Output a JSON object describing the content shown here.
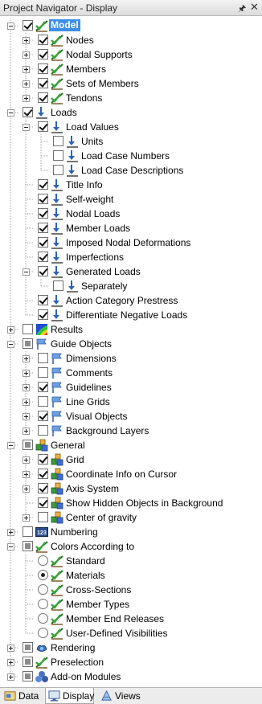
{
  "window": {
    "title": "Project Navigator - Display",
    "pin_icon": "pin-icon",
    "close_icon": "close-icon"
  },
  "tree": [
    {
      "level": 0,
      "label": "Model",
      "check": "checked",
      "icon": "model-icon",
      "expander": "minus",
      "selected": true
    },
    {
      "level": 1,
      "label": "Nodes",
      "check": "checked",
      "icon": "model-icon",
      "expander": "plus"
    },
    {
      "level": 1,
      "label": "Nodal Supports",
      "check": "checked",
      "icon": "model-icon",
      "expander": "plus"
    },
    {
      "level": 1,
      "label": "Members",
      "check": "checked",
      "icon": "model-icon",
      "expander": "plus"
    },
    {
      "level": 1,
      "label": "Sets of Members",
      "check": "checked",
      "icon": "model-icon",
      "expander": "plus"
    },
    {
      "level": 1,
      "label": "Tendons",
      "check": "checked",
      "icon": "model-icon",
      "expander": "plus"
    },
    {
      "level": 0,
      "label": "Loads",
      "check": "checked",
      "icon": "loads-icon",
      "expander": "minus"
    },
    {
      "level": 1,
      "label": "Load Values",
      "check": "checked",
      "icon": "loads-icon",
      "expander": "minus"
    },
    {
      "level": 2,
      "label": "Units",
      "check": "unchecked",
      "icon": "loads-icon",
      "expander": "none"
    },
    {
      "level": 2,
      "label": "Load Case Numbers",
      "check": "unchecked",
      "icon": "loads-icon",
      "expander": "none"
    },
    {
      "level": 2,
      "label": "Load Case Descriptions",
      "check": "unchecked",
      "icon": "loads-icon",
      "expander": "none"
    },
    {
      "level": 1,
      "label": "Title Info",
      "check": "checked",
      "icon": "loads-icon",
      "expander": "none"
    },
    {
      "level": 1,
      "label": "Self-weight",
      "check": "checked",
      "icon": "loads-icon",
      "expander": "none"
    },
    {
      "level": 1,
      "label": "Nodal Loads",
      "check": "checked",
      "icon": "loads-icon",
      "expander": "none"
    },
    {
      "level": 1,
      "label": "Member Loads",
      "check": "checked",
      "icon": "loads-icon",
      "expander": "none"
    },
    {
      "level": 1,
      "label": "Imposed Nodal Deformations",
      "check": "checked",
      "icon": "loads-icon",
      "expander": "none"
    },
    {
      "level": 1,
      "label": "Imperfections",
      "check": "checked",
      "icon": "loads-icon",
      "expander": "none"
    },
    {
      "level": 1,
      "label": "Generated Loads",
      "check": "checked",
      "icon": "loads-icon",
      "expander": "minus"
    },
    {
      "level": 2,
      "label": "Separately",
      "check": "unchecked",
      "icon": "loads-icon",
      "expander": "none"
    },
    {
      "level": 1,
      "label": "Action Category Prestress",
      "check": "checked",
      "icon": "loads-icon",
      "expander": "none"
    },
    {
      "level": 1,
      "label": "Differentiate Negative Loads",
      "check": "checked",
      "icon": "loads-icon",
      "expander": "none"
    },
    {
      "level": 0,
      "label": "Results",
      "check": "unchecked",
      "icon": "results-icon",
      "expander": "plus"
    },
    {
      "level": 0,
      "label": "Guide Objects",
      "check": "partial",
      "icon": "guide-icon",
      "expander": "minus"
    },
    {
      "level": 1,
      "label": "Dimensions",
      "check": "unchecked",
      "icon": "guide-icon",
      "expander": "plus"
    },
    {
      "level": 1,
      "label": "Comments",
      "check": "unchecked",
      "icon": "guide-icon",
      "expander": "plus"
    },
    {
      "level": 1,
      "label": "Guidelines",
      "check": "checked",
      "icon": "guide-icon",
      "expander": "plus"
    },
    {
      "level": 1,
      "label": "Line Grids",
      "check": "unchecked",
      "icon": "guide-icon",
      "expander": "plus"
    },
    {
      "level": 1,
      "label": "Visual Objects",
      "check": "checked",
      "icon": "guide-icon",
      "expander": "plus"
    },
    {
      "level": 1,
      "label": "Background Layers",
      "check": "unchecked",
      "icon": "guide-icon",
      "expander": "plus"
    },
    {
      "level": 0,
      "label": "General",
      "check": "partial",
      "icon": "general-icon",
      "expander": "minus"
    },
    {
      "level": 1,
      "label": "Grid",
      "check": "checked",
      "icon": "general-icon",
      "expander": "plus"
    },
    {
      "level": 1,
      "label": "Coordinate Info on Cursor",
      "check": "checked",
      "icon": "general-icon",
      "expander": "plus"
    },
    {
      "level": 1,
      "label": "Axis System",
      "check": "checked",
      "icon": "general-icon",
      "expander": "plus"
    },
    {
      "level": 1,
      "label": "Show Hidden Objects in Background",
      "check": "checked",
      "icon": "general-icon",
      "expander": "none"
    },
    {
      "level": 1,
      "label": "Center of gravity",
      "check": "unchecked",
      "icon": "general-icon",
      "expander": "plus"
    },
    {
      "level": 0,
      "label": "Numbering",
      "check": "unchecked",
      "icon": "numbering-icon",
      "expander": "plus"
    },
    {
      "level": 0,
      "label": "Colors According to",
      "check": "partial",
      "icon": "model-icon",
      "expander": "minus"
    },
    {
      "level": 1,
      "label": "Standard",
      "check": "radio-off",
      "icon": "model-icon",
      "expander": "none"
    },
    {
      "level": 1,
      "label": "Materials",
      "check": "radio-on",
      "icon": "model-icon",
      "expander": "none"
    },
    {
      "level": 1,
      "label": "Cross-Sections",
      "check": "radio-off",
      "icon": "model-icon",
      "expander": "none"
    },
    {
      "level": 1,
      "label": "Member Types",
      "check": "radio-off",
      "icon": "model-icon",
      "expander": "none"
    },
    {
      "level": 1,
      "label": "Member End Releases",
      "check": "radio-off",
      "icon": "model-icon",
      "expander": "none"
    },
    {
      "level": 1,
      "label": "User-Defined Visibilities",
      "check": "radio-off",
      "icon": "model-icon",
      "expander": "none"
    },
    {
      "level": 0,
      "label": "Rendering",
      "check": "partial",
      "icon": "rendering-icon",
      "expander": "plus"
    },
    {
      "level": 0,
      "label": "Preselection",
      "check": "partial",
      "icon": "model-icon",
      "expander": "plus"
    },
    {
      "level": 0,
      "label": "Add-on Modules",
      "check": "partial",
      "icon": "addon-icon",
      "expander": "plus"
    }
  ],
  "tabs": [
    {
      "label": "Data",
      "icon": "data-tab-icon",
      "active": false
    },
    {
      "label": "Display",
      "icon": "display-tab-icon",
      "active": true
    },
    {
      "label": "Views",
      "icon": "views-tab-icon",
      "active": false
    }
  ],
  "colors": {
    "selection": "#3d8ee6",
    "model_green": "#3aa53a",
    "loads_blue": "#2f63b8"
  }
}
